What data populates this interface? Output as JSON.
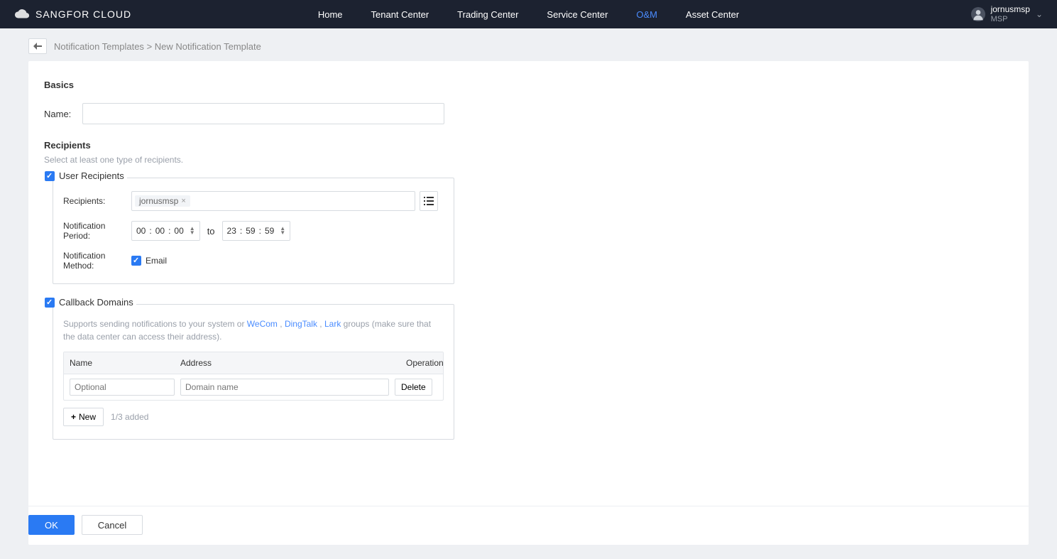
{
  "brand": "SANGFOR CLOUD",
  "nav": {
    "items": [
      "Home",
      "Tenant Center",
      "Trading Center",
      "Service Center",
      "O&M",
      "Asset Center"
    ],
    "active_index": 4
  },
  "user": {
    "name": "jornusmsp",
    "role": "MSP"
  },
  "breadcrumb": {
    "parent": "Notification Templates",
    "sep": ">",
    "current": "New Notification Template"
  },
  "sections": {
    "basics": {
      "title": "Basics",
      "name_label": "Name:",
      "name_value": ""
    },
    "recipients": {
      "title": "Recipients",
      "subtitle": "Select at least one type of recipients."
    },
    "user_recipients": {
      "legend": "User Recipients",
      "checked": true,
      "recipients_label": "Recipients:",
      "recipient_tags": [
        "jornusmsp"
      ],
      "period_label": "Notification Period:",
      "time_from": {
        "h": "00",
        "m": "00",
        "s": "00"
      },
      "to_label": "to",
      "time_to": {
        "h": "23",
        "m": "59",
        "s": "59"
      },
      "method_label": "Notification Method:",
      "email_label": "Email",
      "email_checked": true
    },
    "callback": {
      "legend": "Callback Domains",
      "checked": true,
      "help_pre": "Supports sending notifications to your system or ",
      "links": [
        "WeCom",
        "DingTalk",
        "Lark"
      ],
      "help_post": " groups (make sure that the data center can access their address).",
      "table": {
        "headers": {
          "name": "Name",
          "address": "Address",
          "operation": "Operation"
        },
        "rows": [
          {
            "name_placeholder": "Optional",
            "addr_placeholder": "Domain name",
            "delete": "Delete"
          }
        ]
      },
      "new_btn": "New",
      "count": "1/3 added"
    }
  },
  "footer": {
    "ok": "OK",
    "cancel": "Cancel"
  },
  "colors": {
    "accent": "#2a7af3",
    "nav_active": "#4a8cff"
  }
}
